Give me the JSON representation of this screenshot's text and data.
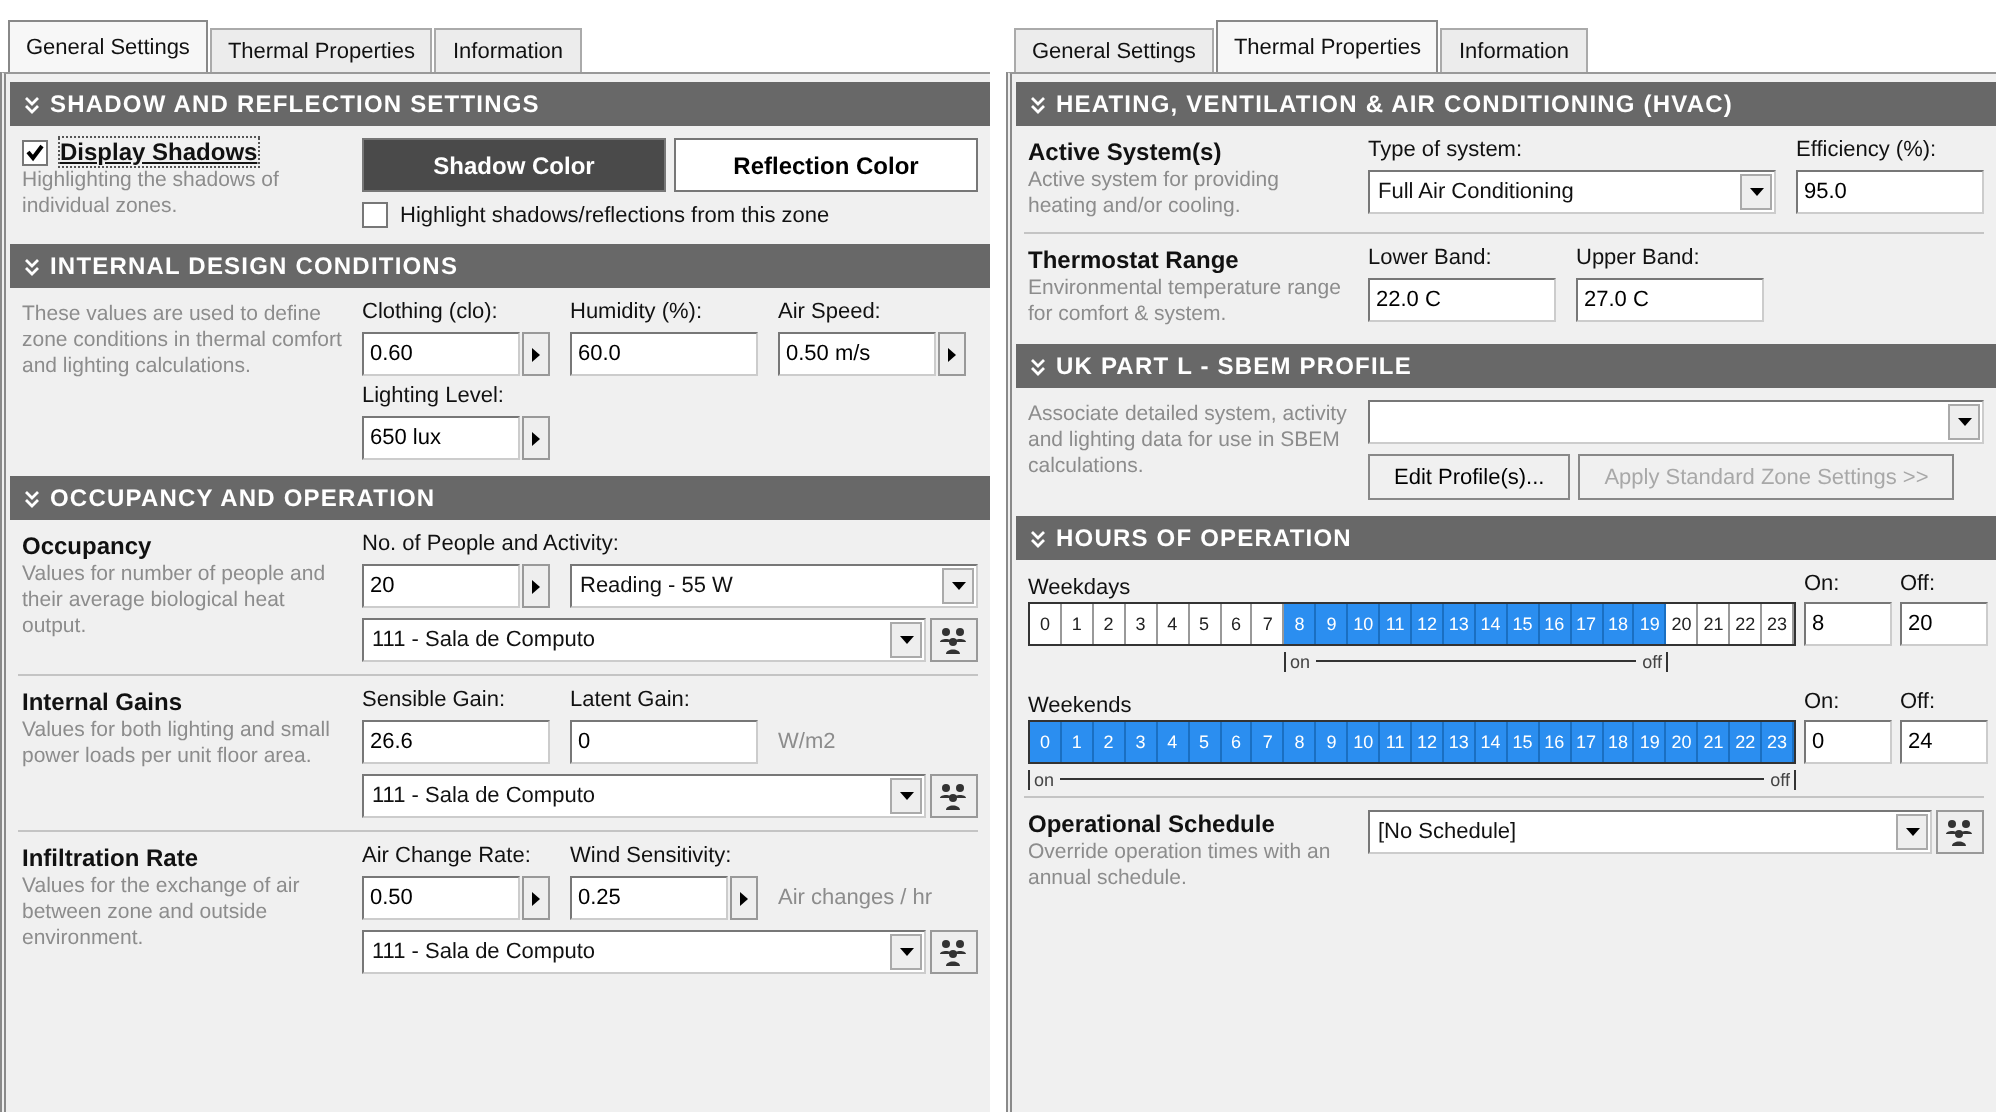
{
  "panels": [
    {
      "tabs": [
        {
          "label": "General Settings",
          "selected": true
        },
        {
          "label": "Thermal Properties",
          "selected": false
        },
        {
          "label": "Information",
          "selected": false
        }
      ],
      "sections": [
        {
          "kind": "shadow",
          "title": "SHADOW AND REFLECTION SETTINGS",
          "checkbox": {
            "label": "Display Shadows",
            "checked": true
          },
          "description": "Highlighting the shadows of individual zones.",
          "buttons": [
            {
              "label": "Shadow Color",
              "selected": true
            },
            {
              "label": "Reflection Color",
              "selected": false
            }
          ],
          "option": {
            "label": "Highlight shadows/reflections from this zone",
            "checked": false
          }
        },
        {
          "kind": "rows",
          "title": "INTERNAL DESIGN CONDITIONS",
          "rows": [
            {
              "description": "These values are used to define zone conditions in thermal comfort and lighting calculations.",
              "fields": [
                {
                  "label": "Clothing (clo):",
                  "kind": "stepper",
                  "value": "0.60"
                },
                {
                  "label": "Humidity (%):",
                  "kind": "text",
                  "value": "60.0"
                },
                {
                  "label": "Air Speed:",
                  "kind": "stepper",
                  "value": "0.50 m/s"
                },
                {
                  "label": "Lighting Level:",
                  "kind": "stepper",
                  "value": "650 lux"
                }
              ]
            }
          ]
        },
        {
          "kind": "rows",
          "title": "OCCUPANCY AND OPERATION",
          "rows": [
            {
              "title": "Occupancy",
              "description": "Values for number of people and their average biological heat output.",
              "fields": [
                {
                  "label": "No. of People and Activity:",
                  "kind": "stepper",
                  "value": "20"
                },
                {
                  "kind": "select",
                  "value": "Reading  -  55 W"
                }
              ],
              "select": {
                "value": "111 - Sala de Computo",
                "button": true
              }
            },
            {
              "title": "Internal Gains",
              "description": "Values for both lighting and small power loads per unit floor area.",
              "fields": [
                {
                  "label": "Sensible Gain:",
                  "kind": "text",
                  "value": "26.6"
                },
                {
                  "label": "Latent Gain:",
                  "kind": "text",
                  "value": "0"
                }
              ],
              "unit": "W/m2",
              "select": {
                "value": "111 - Sala de Computo",
                "button": true
              }
            },
            {
              "title": "Infiltration Rate",
              "description": "Values for the exchange of air between zone and outside environment.",
              "fields": [
                {
                  "label": "Air Change Rate:",
                  "kind": "stepper",
                  "value": "0.50"
                },
                {
                  "label": "Wind Sensitivity:",
                  "kind": "stepper",
                  "value": "0.25"
                }
              ],
              "unit": "Air changes / hr",
              "select": {
                "value": "111 - Sala de Computo",
                "button": true
              }
            }
          ]
        }
      ]
    },
    {
      "tabs": [
        {
          "label": "General Settings",
          "selected": false
        },
        {
          "label": "Thermal Properties",
          "selected": true
        },
        {
          "label": "Information",
          "selected": false
        }
      ],
      "sections": [
        {
          "kind": "rows",
          "title": "HEATING, VENTILATION & AIR CONDITIONING (HVAC)",
          "rows": [
            {
              "title": "Active System(s)",
              "description": "Active system for providing heating and/or cooling.",
              "fields": [
                {
                  "label": "Type of system:",
                  "kind": "select",
                  "value": "Full Air Conditioning"
                },
                {
                  "label": "Efficiency (%):",
                  "kind": "text",
                  "value": "95.0"
                }
              ]
            },
            {
              "title": "Thermostat Range",
              "description": "Environmental temperature range for comfort & system.",
              "fields": [
                {
                  "label": "Lower Band:",
                  "kind": "text",
                  "value": "22.0 C"
                },
                {
                  "label": "Upper Band:",
                  "kind": "text",
                  "value": "27.0 C"
                }
              ]
            }
          ]
        },
        {
          "kind": "rows",
          "title": "UK PART L - SBEM PROFILE",
          "rows": [
            {
              "description": "Associate detailed system, activity and lighting data for use in SBEM calculations.",
              "select": {
                "button": false
              },
              "buttons": [
                {
                  "label": "Edit Profile(s)...",
                  "disabled": false
                },
                {
                  "label": "Apply Standard Zone Settings >>",
                  "disabled": true
                }
              ]
            }
          ]
        },
        {
          "kind": "hours",
          "title": "HOURS OF OPERATION",
          "schedules": [
            {
              "label": "Weekdays",
              "on_label": "On:",
              "on_value": "8",
              "off_label": "Off:",
              "off_value": "20",
              "start_mark": "on",
              "end_mark": "off",
              "hours": [
                {
                  "label": "0",
                  "selected": false
                },
                {
                  "label": "1",
                  "selected": false
                },
                {
                  "label": "2",
                  "selected": false
                },
                {
                  "label": "3",
                  "selected": false
                },
                {
                  "label": "4",
                  "selected": false
                },
                {
                  "label": "5",
                  "selected": false
                },
                {
                  "label": "6",
                  "selected": false
                },
                {
                  "label": "7",
                  "selected": false
                },
                {
                  "label": "8",
                  "selected": true
                },
                {
                  "label": "9",
                  "selected": true
                },
                {
                  "label": "10",
                  "selected": true
                },
                {
                  "label": "11",
                  "selected": true
                },
                {
                  "label": "12",
                  "selected": true
                },
                {
                  "label": "13",
                  "selected": true
                },
                {
                  "label": "14",
                  "selected": true
                },
                {
                  "label": "15",
                  "selected": true
                },
                {
                  "label": "16",
                  "selected": true
                },
                {
                  "label": "17",
                  "selected": true
                },
                {
                  "label": "18",
                  "selected": true
                },
                {
                  "label": "19",
                  "selected": true
                },
                {
                  "label": "20",
                  "selected": false
                },
                {
                  "label": "21",
                  "selected": false
                },
                {
                  "label": "22",
                  "selected": false
                },
                {
                  "label": "23",
                  "selected": false
                }
              ]
            },
            {
              "label": "Weekends",
              "on_label": "On:",
              "on_value": "0",
              "off_label": "Off:",
              "off_value": "24",
              "start_mark": "on",
              "end_mark": "off",
              "hours": [
                {
                  "label": "0",
                  "selected": true
                },
                {
                  "label": "1",
                  "selected": true
                },
                {
                  "label": "2",
                  "selected": true
                },
                {
                  "label": "3",
                  "selected": true
                },
                {
                  "label": "4",
                  "selected": true
                },
                {
                  "label": "5",
                  "selected": true
                },
                {
                  "label": "6",
                  "selected": true
                },
                {
                  "label": "7",
                  "selected": true
                },
                {
                  "label": "8",
                  "selected": true
                },
                {
                  "label": "9",
                  "selected": true
                },
                {
                  "label": "10",
                  "selected": true
                },
                {
                  "label": "11",
                  "selected": true
                },
                {
                  "label": "12",
                  "selected": true
                },
                {
                  "label": "13",
                  "selected": true
                },
                {
                  "label": "14",
                  "selected": true
                },
                {
                  "label": "15",
                  "selected": true
                },
                {
                  "label": "16",
                  "selected": true
                },
                {
                  "label": "17",
                  "selected": true
                },
                {
                  "label": "18",
                  "selected": true
                },
                {
                  "label": "19",
                  "selected": true
                },
                {
                  "label": "20",
                  "selected": true
                },
                {
                  "label": "21",
                  "selected": true
                },
                {
                  "label": "22",
                  "selected": true
                },
                {
                  "label": "23",
                  "selected": true
                }
              ]
            }
          ],
          "rows": [
            {
              "title": "Operational Schedule",
              "description": "Override operation times with an annual schedule.",
              "select": {
                "value": "[No Schedule]",
                "button": true
              }
            }
          ]
        }
      ]
    }
  ]
}
